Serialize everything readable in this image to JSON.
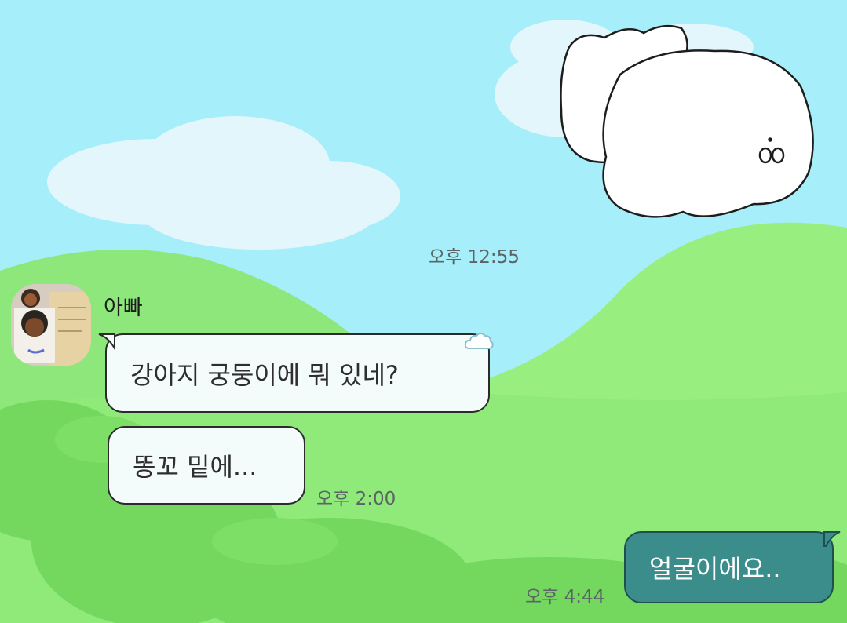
{
  "colors": {
    "sky": "#a6eef9",
    "hill_light": "#8fec7b",
    "hill_bright": "#9aef80",
    "bush": "#74d75e",
    "cloud": "#e3f6fb",
    "incoming_bubble": "#f4fbfb",
    "outgoing_bubble": "#3b8d8c"
  },
  "chat": {
    "date_separator_time": "오후 12:55",
    "sender": {
      "name": "아빠",
      "avatar_icon": "profile-photo-avatar"
    },
    "messages": [
      {
        "direction": "incoming",
        "text": "강아지 궁둥이에 뭐 있네?",
        "time": "",
        "reaction_icon": "cloud-icon"
      },
      {
        "direction": "incoming",
        "text": "똥꼬 밑에...",
        "time": "오후 2:00"
      },
      {
        "direction": "outgoing",
        "text": "얼굴이에요..",
        "time": "오후 4:44"
      }
    ]
  }
}
